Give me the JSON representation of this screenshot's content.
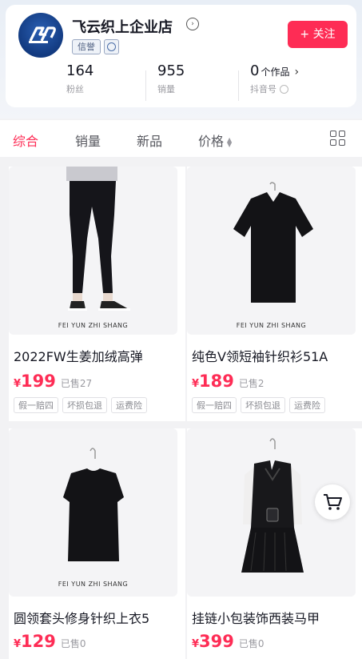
{
  "shop": {
    "logo_text": "ᗩ",
    "name": "飞云织上企业店",
    "badge": "信誉",
    "follow_label": "+ 关注",
    "stats": [
      {
        "value": "164",
        "unit": "",
        "label": "粉丝"
      },
      {
        "value": "955",
        "unit": "",
        "label": "销量"
      },
      {
        "value": "0",
        "unit": "个作品",
        "label": "抖音号"
      }
    ]
  },
  "sort": {
    "tabs": [
      "综合",
      "销量",
      "新品",
      "价格"
    ],
    "active_index": 0
  },
  "brand_caption": "FEI YUN ZHI SHANG",
  "products": [
    {
      "title": "2022FW生姜加绒高弹",
      "currency": "¥",
      "price": "199",
      "sold": "已售27",
      "tags": [
        "假一赔四",
        "坏损包退",
        "运费险"
      ]
    },
    {
      "title": "纯色V领短袖针织衫51A",
      "currency": "¥",
      "price": "189",
      "sold": "已售2",
      "tags": [
        "假一赔四",
        "坏损包退",
        "运费险"
      ]
    },
    {
      "title": "圆领套头修身针织上衣5",
      "currency": "¥",
      "price": "129",
      "sold": "已售0",
      "tags": []
    },
    {
      "title": "挂链小包装饰西装马甲",
      "currency": "¥",
      "price": "399",
      "sold": "已售0",
      "tags": []
    }
  ],
  "colors": {
    "accent": "#fe2c55",
    "text": "#161823",
    "muted": "#9b9ba1"
  }
}
